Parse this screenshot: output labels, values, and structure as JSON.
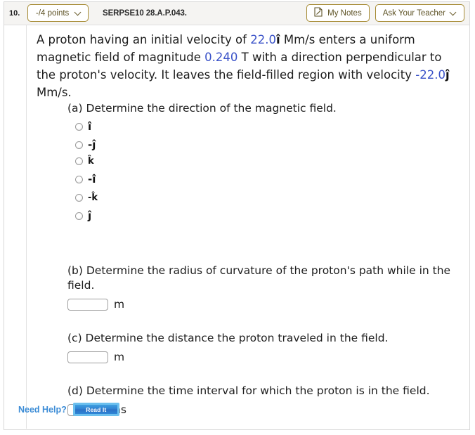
{
  "header": {
    "question_number": "10.",
    "points_label": "-/4 points",
    "question_code": "SERPSE10 28.A.P.043.",
    "my_notes_label": "My Notes",
    "ask_teacher_label": "Ask Your Teacher"
  },
  "stem": {
    "t1": "A proton having an initial velocity of ",
    "v1": "22.0",
    "u1": "î",
    "t2": " Mm/s enters a uniform magnetic field of magnitude ",
    "v2": "0.240",
    "t3": " T with a direction perpendicular to the proton's velocity. It leaves the field-filled region with velocity ",
    "v3": "-22.0",
    "u2": "ĵ",
    "t4": " Mm/s."
  },
  "parts": {
    "a": {
      "prompt": "(a) Determine the direction of the magnetic field.",
      "options": [
        {
          "label": "î"
        },
        {
          "label": "-ĵ"
        },
        {
          "label": "k̂"
        },
        {
          "label": "-î"
        },
        {
          "label": "-k̂"
        },
        {
          "label": "ĵ"
        }
      ]
    },
    "b": {
      "prompt": "(b) Determine the radius of curvature of the proton's path while in the field.",
      "value": "",
      "unit": "m"
    },
    "c": {
      "prompt": "(c) Determine the distance the proton traveled in the field.",
      "value": "",
      "unit": "m"
    },
    "d": {
      "prompt": "(d) Determine the time interval for which the proton is in the field.",
      "value": "",
      "unit": "ns"
    }
  },
  "footer": {
    "need_help_label": "Need Help?",
    "read_it_label": "Read It"
  },
  "colors": {
    "accent_gold": "#a58a32",
    "number_blue": "#3a52c8",
    "help_blue": "#3c8cd6"
  }
}
